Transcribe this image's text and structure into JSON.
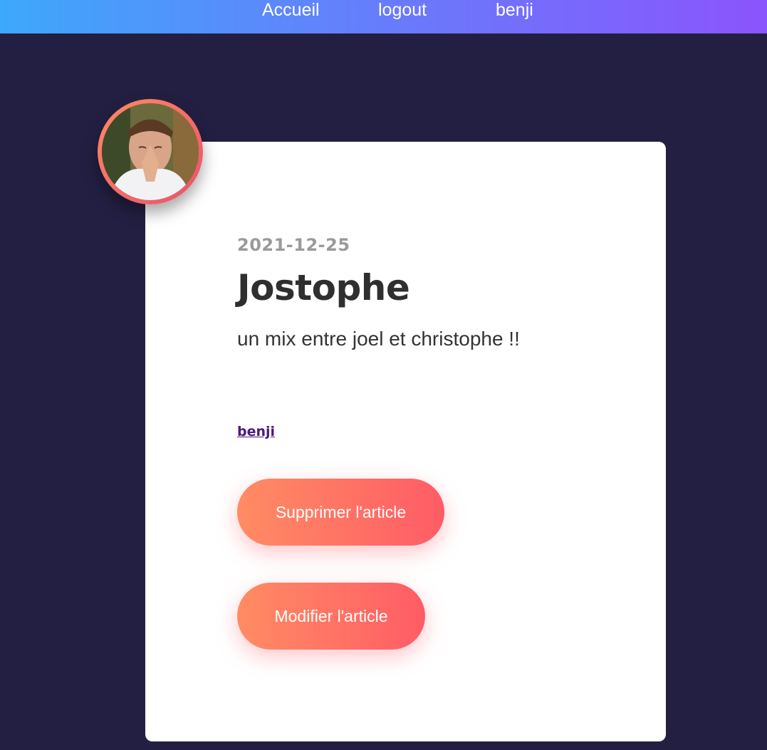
{
  "nav": {
    "links": [
      {
        "label": "Accueil"
      },
      {
        "label": "logout"
      },
      {
        "label": "benji"
      }
    ]
  },
  "article": {
    "date": "2021-12-25",
    "title": "Jostophe",
    "description": "un mix entre joel et christophe !!",
    "author": "benji",
    "actions": {
      "delete_label": "Supprimer l'article",
      "edit_label": "Modifier l'article"
    }
  },
  "colors": {
    "background": "#231f42",
    "navbar_gradient_start": "#3ea8fb",
    "navbar_gradient_end": "#8b54fc",
    "button_gradient_start": "#ff8c63",
    "button_gradient_end": "#ff5c66"
  }
}
